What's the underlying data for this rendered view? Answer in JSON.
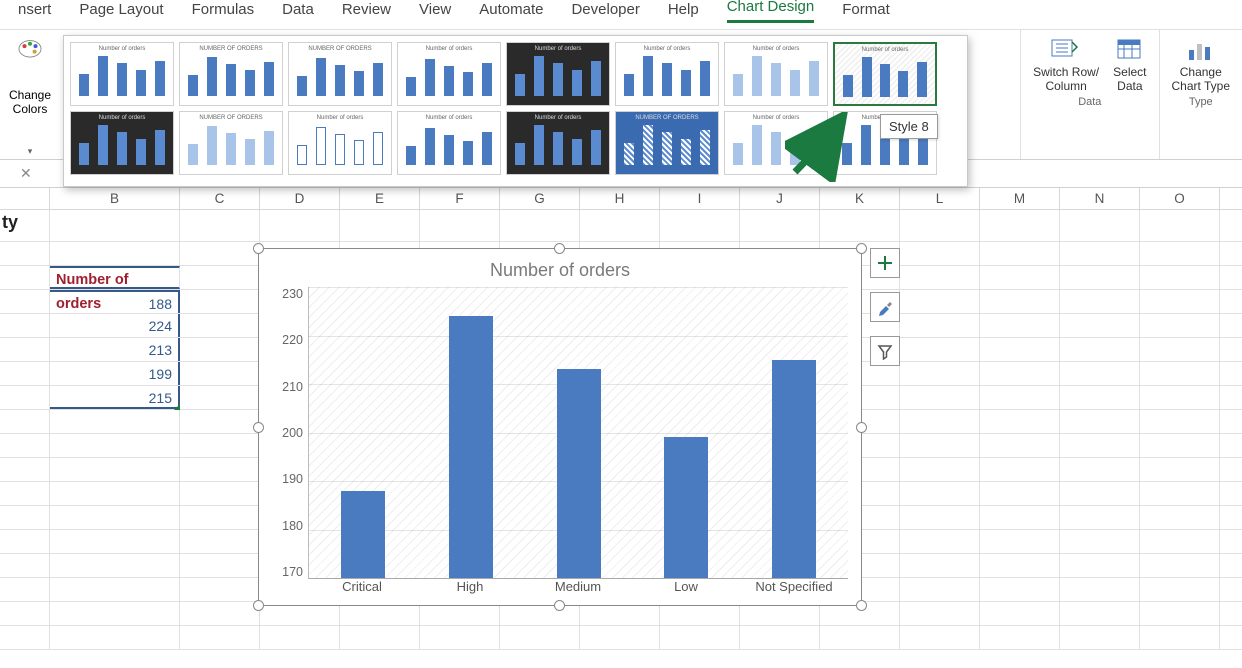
{
  "tabs": {
    "insert": "nsert",
    "page_layout": "Page Layout",
    "formulas": "Formulas",
    "data": "Data",
    "review": "Review",
    "view": "View",
    "automate": "Automate",
    "developer": "Developer",
    "help": "Help",
    "chart_design": "Chart Design",
    "format": "Format"
  },
  "ribbon": {
    "change_colors": "Change\nColors",
    "style_tooltip": "Style 8",
    "switch_rc": "Switch Row/\nColumn",
    "select_data": "Select\nData",
    "change_ct": "Change\nChart Type",
    "group_data": "Data",
    "group_type": "Type",
    "thumb_title": "Number of orders",
    "thumb_title_caps": "NUMBER OF ORDERS"
  },
  "sheet": {
    "ty": "ty",
    "header_b": "Number of orders",
    "b2": "188",
    "b3": "224",
    "b4": "213",
    "b5": "199",
    "b6": "215",
    "cols": [
      "B",
      "C",
      "D",
      "E",
      "F",
      "G",
      "H",
      "I",
      "J",
      "K",
      "L",
      "M",
      "N",
      "O"
    ]
  },
  "chart_data": {
    "type": "bar",
    "title": "Number of orders",
    "categories": [
      "Critical",
      "High",
      "Medium",
      "Low",
      "Not Specified"
    ],
    "values": [
      188,
      224,
      213,
      199,
      215
    ],
    "ylim": [
      170,
      230
    ],
    "yticks": [
      170,
      180,
      190,
      200,
      210,
      220,
      230
    ],
    "xlabel": "",
    "ylabel": ""
  },
  "side_buttons": {
    "plus": "+",
    "brush": "brush",
    "filter": "filter"
  }
}
